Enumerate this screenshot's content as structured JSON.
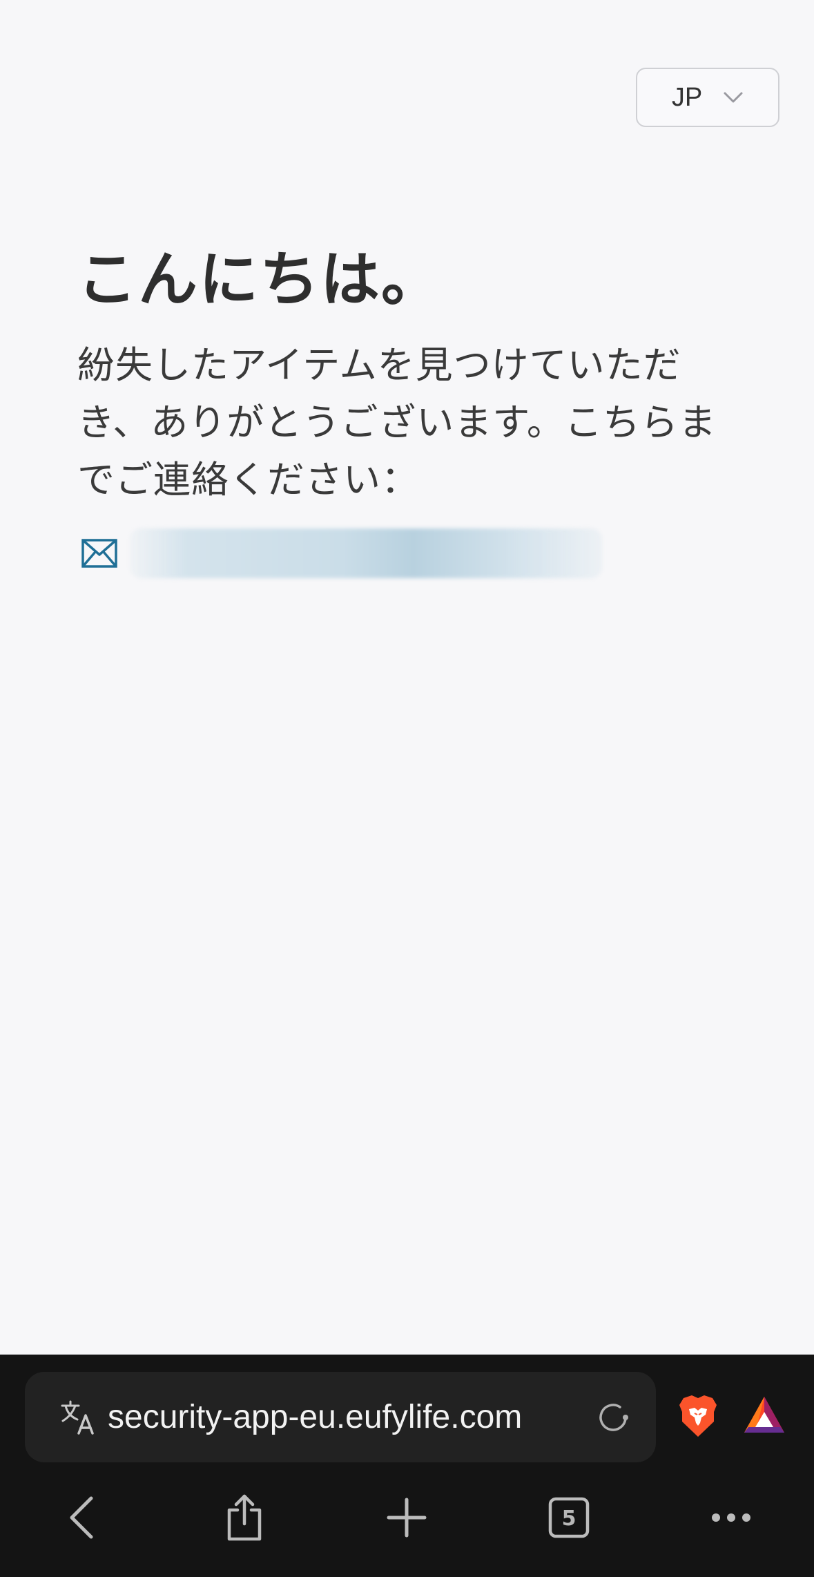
{
  "language_selector": {
    "value": "JP"
  },
  "main": {
    "greeting": "こんにちは。",
    "message": "紛失したアイテムを見つけていただき、ありがとうございます。こちらまでご連絡ください：",
    "email": ""
  },
  "browser": {
    "url": "security-app-eu.eufylife.com",
    "tab_count": "5"
  },
  "colors": {
    "background": "#f7f7f9",
    "text": "#2e2e2e",
    "mail_icon": "#1f6f96",
    "browser_bar": "#141414",
    "brave_orange": "#fb542b"
  }
}
